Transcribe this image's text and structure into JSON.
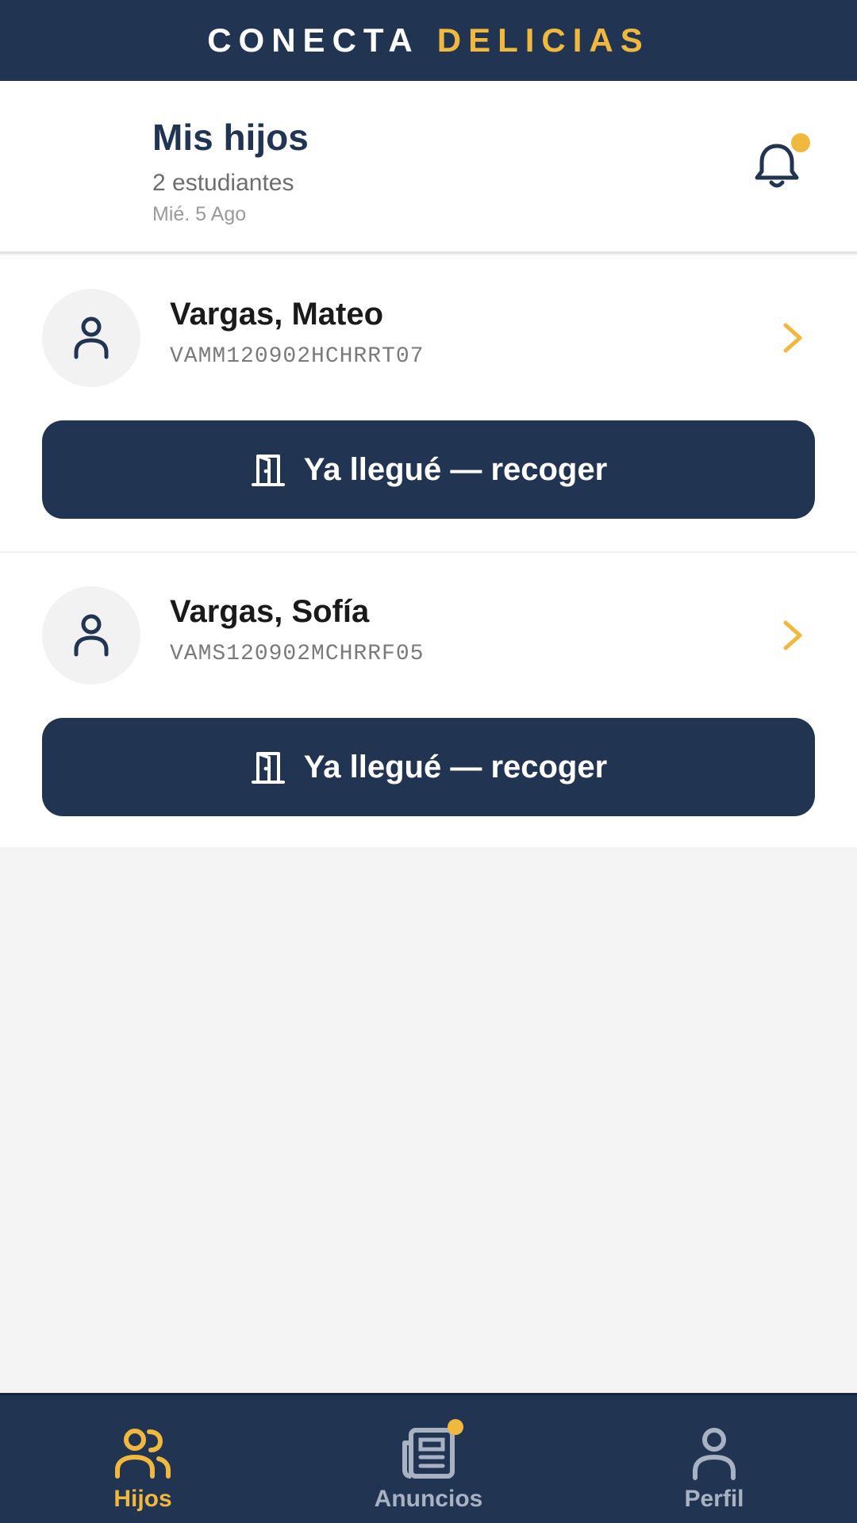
{
  "brand": {
    "word1": "CONECTA",
    "word2": "DELICIAS"
  },
  "header": {
    "title": "Mis hijos",
    "subtitle": "2 estudiantes",
    "date": "Mié. 5 Ago"
  },
  "students": [
    {
      "name": "Vargas, Mateo",
      "id": "VAMM120902HCHRRT07",
      "action_label": "Ya llegué — recoger"
    },
    {
      "name": "Vargas, Sofía",
      "id": "VAMS120902MCHRRF05",
      "action_label": "Ya llegué — recoger"
    }
  ],
  "tabs": [
    {
      "label": "Hijos",
      "icon": "users-icon",
      "active": true
    },
    {
      "label": "Anuncios",
      "icon": "newspaper-icon",
      "active": false
    },
    {
      "label": "Perfil",
      "icon": "user-icon",
      "active": false
    }
  ],
  "colors": {
    "navy": "#213553",
    "accent": "#f1b83e",
    "background": "#f4f4f4"
  }
}
